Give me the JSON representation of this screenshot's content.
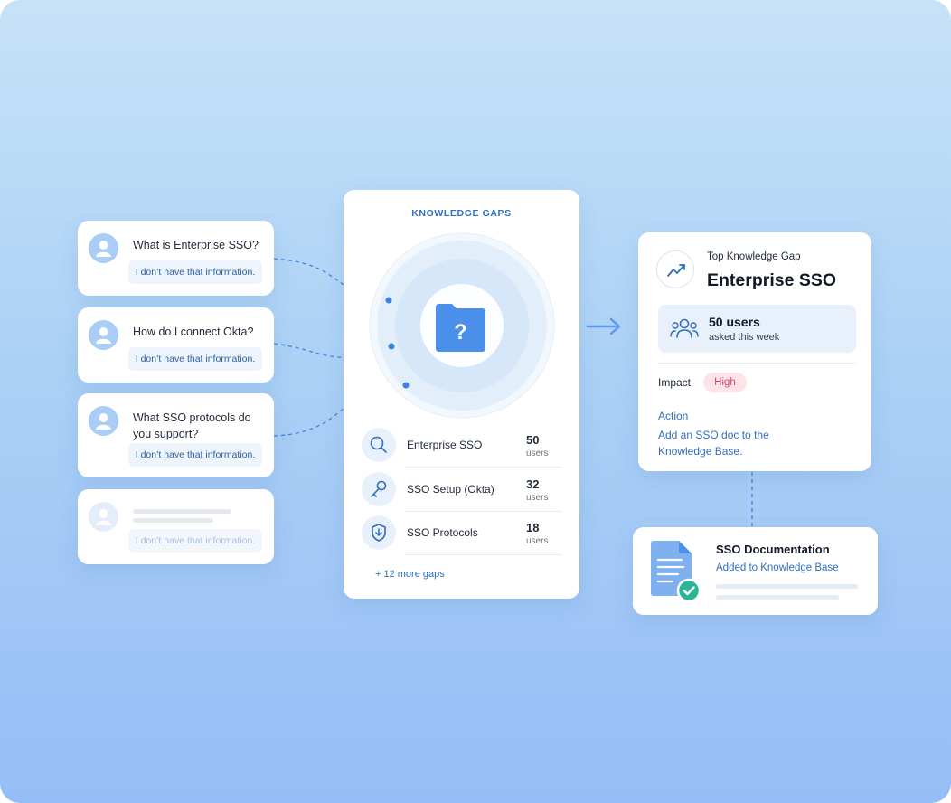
{
  "questions": [
    {
      "text": "What is Enterprise SSO?",
      "answer": "I don’t have that information."
    },
    {
      "text": "How do I connect Okta?",
      "answer": "I don’t have that information."
    },
    {
      "text": "What SSO protocols do you support?",
      "answer": "I don’t have that information."
    },
    {
      "text": "",
      "answer": "I don’t have that information."
    }
  ],
  "knowledge_gaps": {
    "title": "KNOWLEDGE GAPS",
    "items": [
      {
        "icon": "search-icon",
        "label": "Enterprise SSO",
        "count": "50",
        "unit": "users"
      },
      {
        "icon": "key-icon",
        "label": "SSO Setup (Okta)",
        "count": "32",
        "unit": "users"
      },
      {
        "icon": "shield-icon",
        "label": "SSO Protocols",
        "count": "18",
        "unit": "users"
      }
    ],
    "more": "+ 12 more gaps",
    "center_icon": "folder-question-icon"
  },
  "top_gap": {
    "icon": "trending-up-icon",
    "label": "Top Knowledge Gap",
    "title": "Enterprise SSO",
    "users_icon": "users-icon",
    "users": "50 users",
    "users_sub": "asked this week",
    "impact_label": "Impact",
    "impact_value": "High",
    "action_label": "Action",
    "action_text": "Add an SSO doc to the Knowledge Base."
  },
  "doc": {
    "icon": "document-check-icon",
    "title": "SSO Documentation",
    "subtitle": "Added to Knowledge Base"
  },
  "colors": {
    "accent": "#2f6fbe",
    "badge_high": "#d9476a",
    "success": "#2bb597",
    "background_top": "#c7e2f7",
    "background_bottom": "#96bef6"
  }
}
